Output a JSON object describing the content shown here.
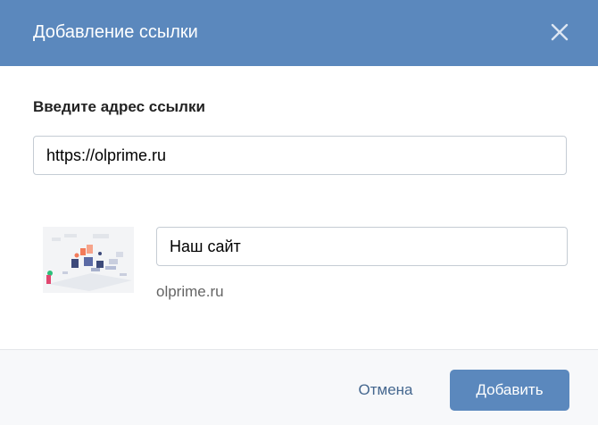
{
  "dialog": {
    "title": "Добавление ссылки",
    "close_icon": "close-icon"
  },
  "form": {
    "url_label": "Введите адрес ссылки",
    "url_value": "https://olprime.ru",
    "title_value": "Наш сайт",
    "domain": "olprime.ru"
  },
  "preview": {
    "icon": "site-preview-image"
  },
  "footer": {
    "cancel_label": "Отмена",
    "add_label": "Добавить"
  },
  "colors": {
    "header_bg": "#5b88bd",
    "primary_button": "#5b88bd",
    "link_text": "#45678f",
    "footer_bg": "#f7f8fa"
  }
}
